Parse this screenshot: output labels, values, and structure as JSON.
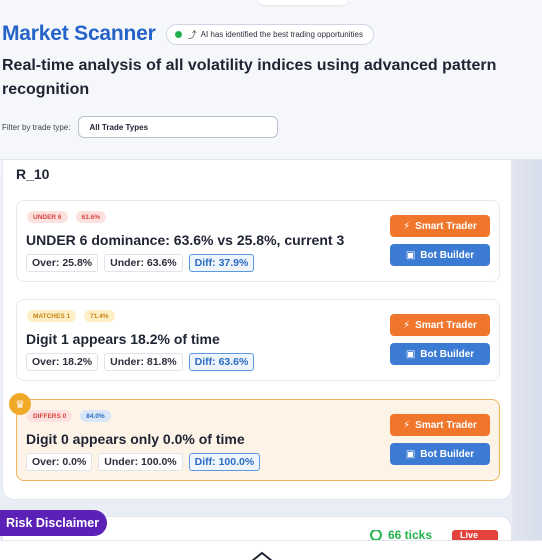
{
  "header": {
    "title": "Market Scanner",
    "ai_badge": "AI has identified the best trading opportunities",
    "subtitle": "Real-time analysis of all volatility indices using advanced pattern recognition",
    "filter_label": "Filter by trade type:",
    "filter_value": "All Trade Types"
  },
  "panel": {
    "symbol": "R_10",
    "cards": [
      {
        "type_tag": "UNDER 6",
        "pct_tag": "63.6%",
        "description": "UNDER 6 dominance: 63.6% vs 25.8%, current 3",
        "over": "Over: 25.8%",
        "under": "Under: 63.6%",
        "diff": "Diff: 37.9%",
        "smart_label": "Smart Trader",
        "bot_label": "Bot Builder"
      },
      {
        "type_tag": "MATCHES 1",
        "pct_tag": "71.4%",
        "description": "Digit 1 appears 18.2% of time",
        "over": "Over: 18.2%",
        "under": "Under: 81.8%",
        "diff": "Diff: 63.6%",
        "smart_label": "Smart Trader",
        "bot_label": "Bot Builder"
      },
      {
        "type_tag": "DIFFERS 0",
        "pct_tag": "84.0%",
        "description": "Digit 0 appears only 0.0% of time",
        "over": "Over: 0.0%",
        "under": "Under: 100.0%",
        "diff": "Diff: 100.0%",
        "smart_label": "Smart Trader",
        "bot_label": "Bot Builder"
      }
    ]
  },
  "next_card": {
    "ticks": "66 ticks",
    "live": "Live"
  },
  "risk_disclaimer": "Risk Disclaimer",
  "colors": {
    "title_blue": "#2563c9",
    "smart_orange": "#f0762c",
    "bot_blue": "#3b7bd4",
    "risk_purple": "#5b21b6",
    "highlight_border": "#f1b35c"
  }
}
